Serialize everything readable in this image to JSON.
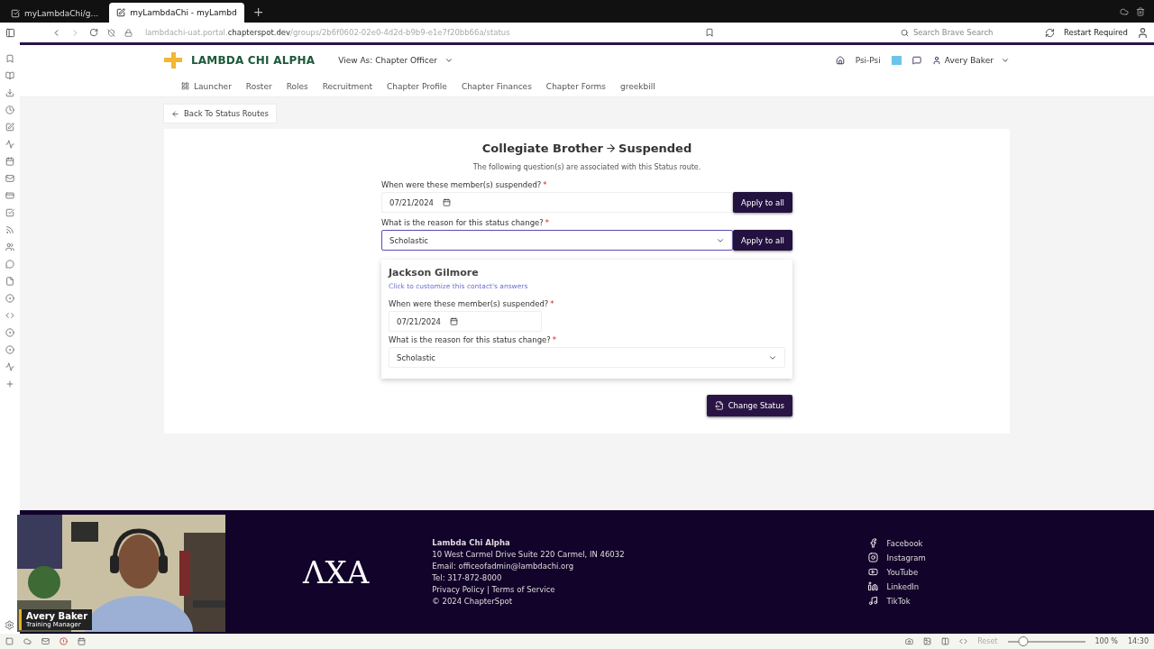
{
  "browser": {
    "tabs": [
      {
        "title": "myLambdaChi/g...",
        "selected": false
      },
      {
        "title": "myLambdaChi - myLambd",
        "selected": true
      }
    ],
    "new_tab": "+",
    "url": {
      "prefix": "lambdachi-uat.portal.",
      "domain": "chapterspot.dev",
      "path": "/groups/2b6f0602-02e0-4d2d-b9b9-e1e7f20bb66a/status"
    },
    "search": {
      "placeholder": "Search Brave Search"
    },
    "restart": "Restart Required"
  },
  "site": {
    "logo": "LAMBDA CHI ALPHA",
    "view_as": "View As: Chapter Officer",
    "chapter": "Psi-Psi",
    "user": "Avery Baker",
    "nav": [
      "Launcher",
      "Roster",
      "Roles",
      "Recruitment",
      "Chapter Profile",
      "Chapter Finances",
      "Chapter Forms",
      "greekbill"
    ]
  },
  "back": "Back To Status Routes",
  "form": {
    "from": "Collegiate Brother",
    "to": "Suspended",
    "subtitle": "The following question(s) are associated with this Status route.",
    "questions": [
      {
        "kind": "date",
        "label": "When were these member(s) suspended?",
        "mark": "*",
        "value": "07/21/2024",
        "focused": false,
        "button": "Apply to all"
      },
      {
        "kind": "select",
        "label": "What is the reason for this status change?",
        "mark": "*",
        "value": "Scholastic",
        "focused": true,
        "button": "Apply to all"
      }
    ],
    "members": [
      {
        "name": "Jackson Gilmore",
        "link": "Click to customize this contact's answers",
        "answers": [
          {
            "kind": "date",
            "label": "When were these member(s) suspended?",
            "mark": "*",
            "value": "07/21/2024"
          },
          {
            "kind": "select",
            "label": "What is the reason for this status change?",
            "mark": "*",
            "value": "Scholastic"
          }
        ]
      }
    ],
    "submit": "Change Status"
  },
  "footer": {
    "monogram": "ΛΧΑ",
    "org": "Lambda Chi Alpha",
    "lines": [
      "10 West Carmel Drive Suite 220 Carmel, IN 46032",
      "Email: officeofadmin@lambdachi.org",
      "Tel: 317-872-8000",
      "Privacy Policy | Terms of Service",
      "© 2024 ChapterSpot"
    ],
    "social": [
      {
        "kind": "facebook",
        "label": "Facebook"
      },
      {
        "kind": "instagram",
        "label": "Instagram"
      },
      {
        "kind": "youtube",
        "label": "YouTube"
      },
      {
        "kind": "linkedin",
        "label": "LinkedIn"
      },
      {
        "kind": "tiktok",
        "label": "TikTok"
      }
    ]
  },
  "video": {
    "kind": "picture",
    "name": "Avery Baker",
    "role": "Training Manager"
  },
  "status_bar": {
    "reset": "Reset",
    "zoom": {
      "level": 0.2,
      "reading": "100 %"
    },
    "time": "14:30"
  }
}
